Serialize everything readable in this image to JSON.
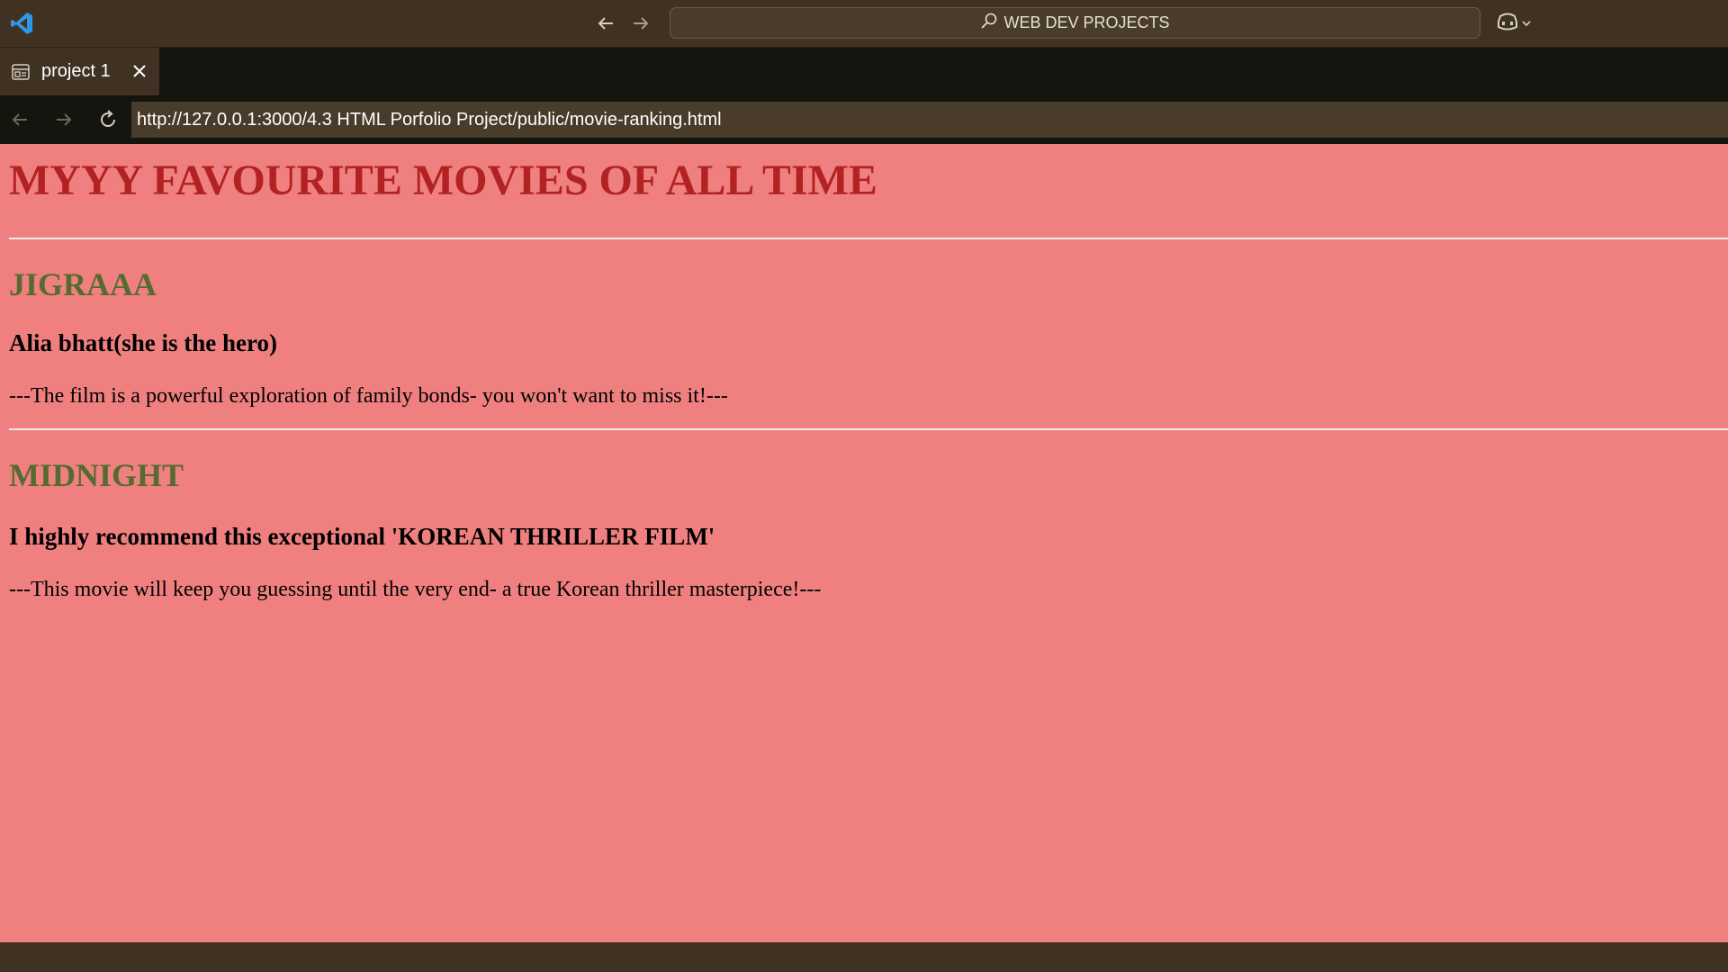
{
  "titlebar": {
    "search_text": "WEB DEV PROJECTS"
  },
  "tab": {
    "label": "project 1"
  },
  "address_bar": {
    "url": "http://127.0.0.1:3000/4.3 HTML Porfolio Project/public/movie-ranking.html"
  },
  "page": {
    "title": "MYYY FAVOURITE MOVIES OF ALL TIME",
    "movies": [
      {
        "name": "JIGRAAA",
        "subtitle": "Alia bhatt(she is the hero)",
        "description": "---The film is a powerful exploration of family bonds- you won't want to miss it!---"
      },
      {
        "name": "MIDNIGHT",
        "subtitle": "I highly recommend this exceptional 'KOREAN THRILLER FILM'",
        "description": "---This movie will keep you guessing until the very end- a true Korean thriller masterpiece!---"
      }
    ]
  },
  "colors": {
    "page_background": "#f08080",
    "title_color": "#b22222",
    "movie_name_color": "#556b2f",
    "chrome_background": "#3f3222",
    "tabbar_background": "#151510"
  },
  "icons": {
    "app": "vscode-logo-icon",
    "back": "arrow-left-icon",
    "forward": "arrow-right-icon",
    "search": "search-icon",
    "copilot": "copilot-icon",
    "tab": "preview-icon",
    "close": "close-icon",
    "reload": "reload-icon"
  }
}
